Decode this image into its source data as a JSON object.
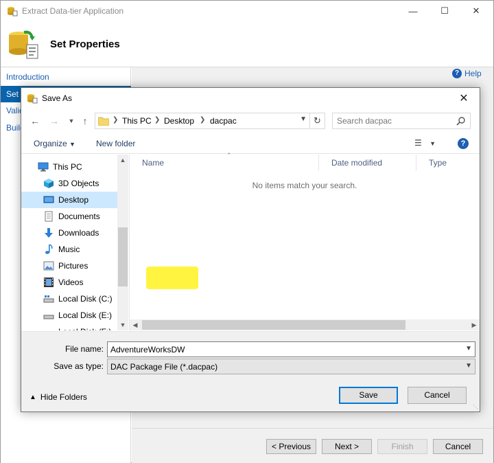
{
  "wizard": {
    "title": "Extract Data-tier Application",
    "header_title": "Set Properties",
    "nav": {
      "introduction": "Introduction",
      "set_properties": "Set P",
      "validation": "Valid",
      "build": "Build"
    },
    "help_label": "Help",
    "buttons": {
      "previous": "< Previous",
      "next": "Next >",
      "finish": "Finish",
      "cancel": "Cancel"
    }
  },
  "dialog": {
    "title": "Save As",
    "breadcrumb": [
      "This PC",
      "Desktop",
      "dacpac"
    ],
    "search_placeholder": "Search dacpac",
    "toolbar": {
      "organize": "Organize",
      "new_folder": "New folder"
    },
    "tree": [
      {
        "label": "This PC",
        "icon": "monitor-icon"
      },
      {
        "label": "3D Objects",
        "icon": "cube-icon"
      },
      {
        "label": "Desktop",
        "icon": "desktop-icon",
        "selected": true
      },
      {
        "label": "Documents",
        "icon": "document-icon"
      },
      {
        "label": "Downloads",
        "icon": "download-icon"
      },
      {
        "label": "Music",
        "icon": "music-icon"
      },
      {
        "label": "Pictures",
        "icon": "picture-icon"
      },
      {
        "label": "Videos",
        "icon": "video-icon"
      },
      {
        "label": "Local Disk (C:)",
        "icon": "disk-icon"
      },
      {
        "label": "Local Disk (E:)",
        "icon": "disk-icon"
      },
      {
        "label": "Local Disk (F:)",
        "icon": "disk-icon"
      }
    ],
    "columns": [
      "Name",
      "Date modified",
      "Type"
    ],
    "empty_message": "No items match your search.",
    "file_name_label": "File name:",
    "file_name_value": "AdventureWorksDW",
    "save_type_label": "Save as type:",
    "save_type_value": "DAC Package File (*.dacpac)",
    "hide_folders": "Hide Folders",
    "save_button": "Save",
    "cancel_button": "Cancel",
    "highlight_color": "#fff200"
  }
}
